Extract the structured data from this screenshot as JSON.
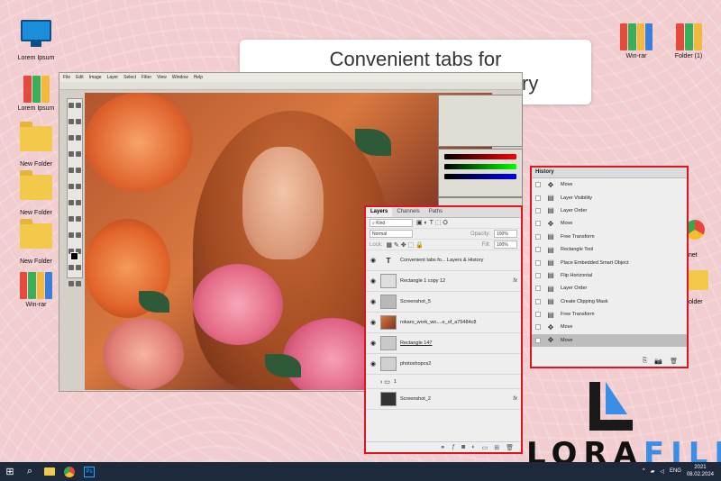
{
  "callout": {
    "line1": "Convenient tabs for",
    "line2": "previewing Layers & History"
  },
  "desktop_icons": [
    {
      "name": "computer",
      "label": "Lorem Ipsum"
    },
    {
      "name": "winrar-books",
      "label": "Lorem Ipsum"
    },
    {
      "name": "folder",
      "label": "New Folder"
    },
    {
      "name": "folder",
      "label": "New Folder"
    },
    {
      "name": "folder",
      "label": "New Folder"
    },
    {
      "name": "winrar-books",
      "label": "Win-rar"
    }
  ],
  "desktop_icons_right": [
    {
      "name": "winrar-books",
      "label": "Win-rar"
    },
    {
      "name": "folder-books",
      "label": "Folder (1)"
    }
  ],
  "partial_labels": {
    "net": "net",
    "older": "older"
  },
  "ps": {
    "menu": [
      "File",
      "Edit",
      "Image",
      "Layer",
      "Select",
      "Filter",
      "View",
      "Window",
      "Help"
    ]
  },
  "layers_panel": {
    "tabs": [
      "Layers",
      "Channels",
      "Paths"
    ],
    "kind_label": "Kind",
    "blend_mode": "Normal",
    "opacity_label": "Opacity:",
    "opacity_value": "100%",
    "lock_label": "Lock:",
    "fill_label": "Fill:",
    "fill_value": "100%",
    "layers": [
      {
        "name": "Convenient tabs fo... Layers & History",
        "type": "text",
        "fx": ""
      },
      {
        "name": "Rectangle 1 copy 12",
        "type": "shape",
        "fx": "fx"
      },
      {
        "name": "Screenshot_5",
        "type": "image",
        "fx": ""
      },
      {
        "name": "rokaro_work_wo....e_of_a75484c8",
        "type": "photo",
        "fx": ""
      },
      {
        "name": "Rectangle 147",
        "type": "shape",
        "fx": ""
      },
      {
        "name": "photoshopcs2",
        "type": "image",
        "fx": ""
      },
      {
        "name": "1",
        "type": "group",
        "fx": ""
      },
      {
        "name": "Screenshot_2",
        "type": "image",
        "fx": "fx"
      }
    ]
  },
  "history_panel": {
    "title": "History",
    "items": [
      {
        "label": "Move",
        "icon": "move-icon"
      },
      {
        "label": "Layer Visibility",
        "icon": "doc-icon"
      },
      {
        "label": "Layer Order",
        "icon": "doc-icon"
      },
      {
        "label": "Move",
        "icon": "move-icon"
      },
      {
        "label": "Free Transform",
        "icon": "doc-icon"
      },
      {
        "label": "Rectangle Tool",
        "icon": "doc-icon"
      },
      {
        "label": "Place Embedded Smart Object",
        "icon": "doc-icon"
      },
      {
        "label": "Flip Horizontal",
        "icon": "doc-icon"
      },
      {
        "label": "Layer Order",
        "icon": "doc-icon"
      },
      {
        "label": "Create Clipping Mask",
        "icon": "doc-icon"
      },
      {
        "label": "Free Transform",
        "icon": "doc-icon"
      },
      {
        "label": "Move",
        "icon": "move-icon"
      },
      {
        "label": "Move",
        "icon": "move-icon",
        "active": true
      }
    ]
  },
  "logo": {
    "text_main": "LORA",
    "text_accent": "FILE"
  },
  "taskbar": {
    "lang": "ENG",
    "time": "2021",
    "date": "08.02.2024"
  },
  "colors": {
    "panel_border": "#e0141e",
    "taskbar": "#1c2a3b",
    "logo_accent": "#3a8ee6"
  }
}
